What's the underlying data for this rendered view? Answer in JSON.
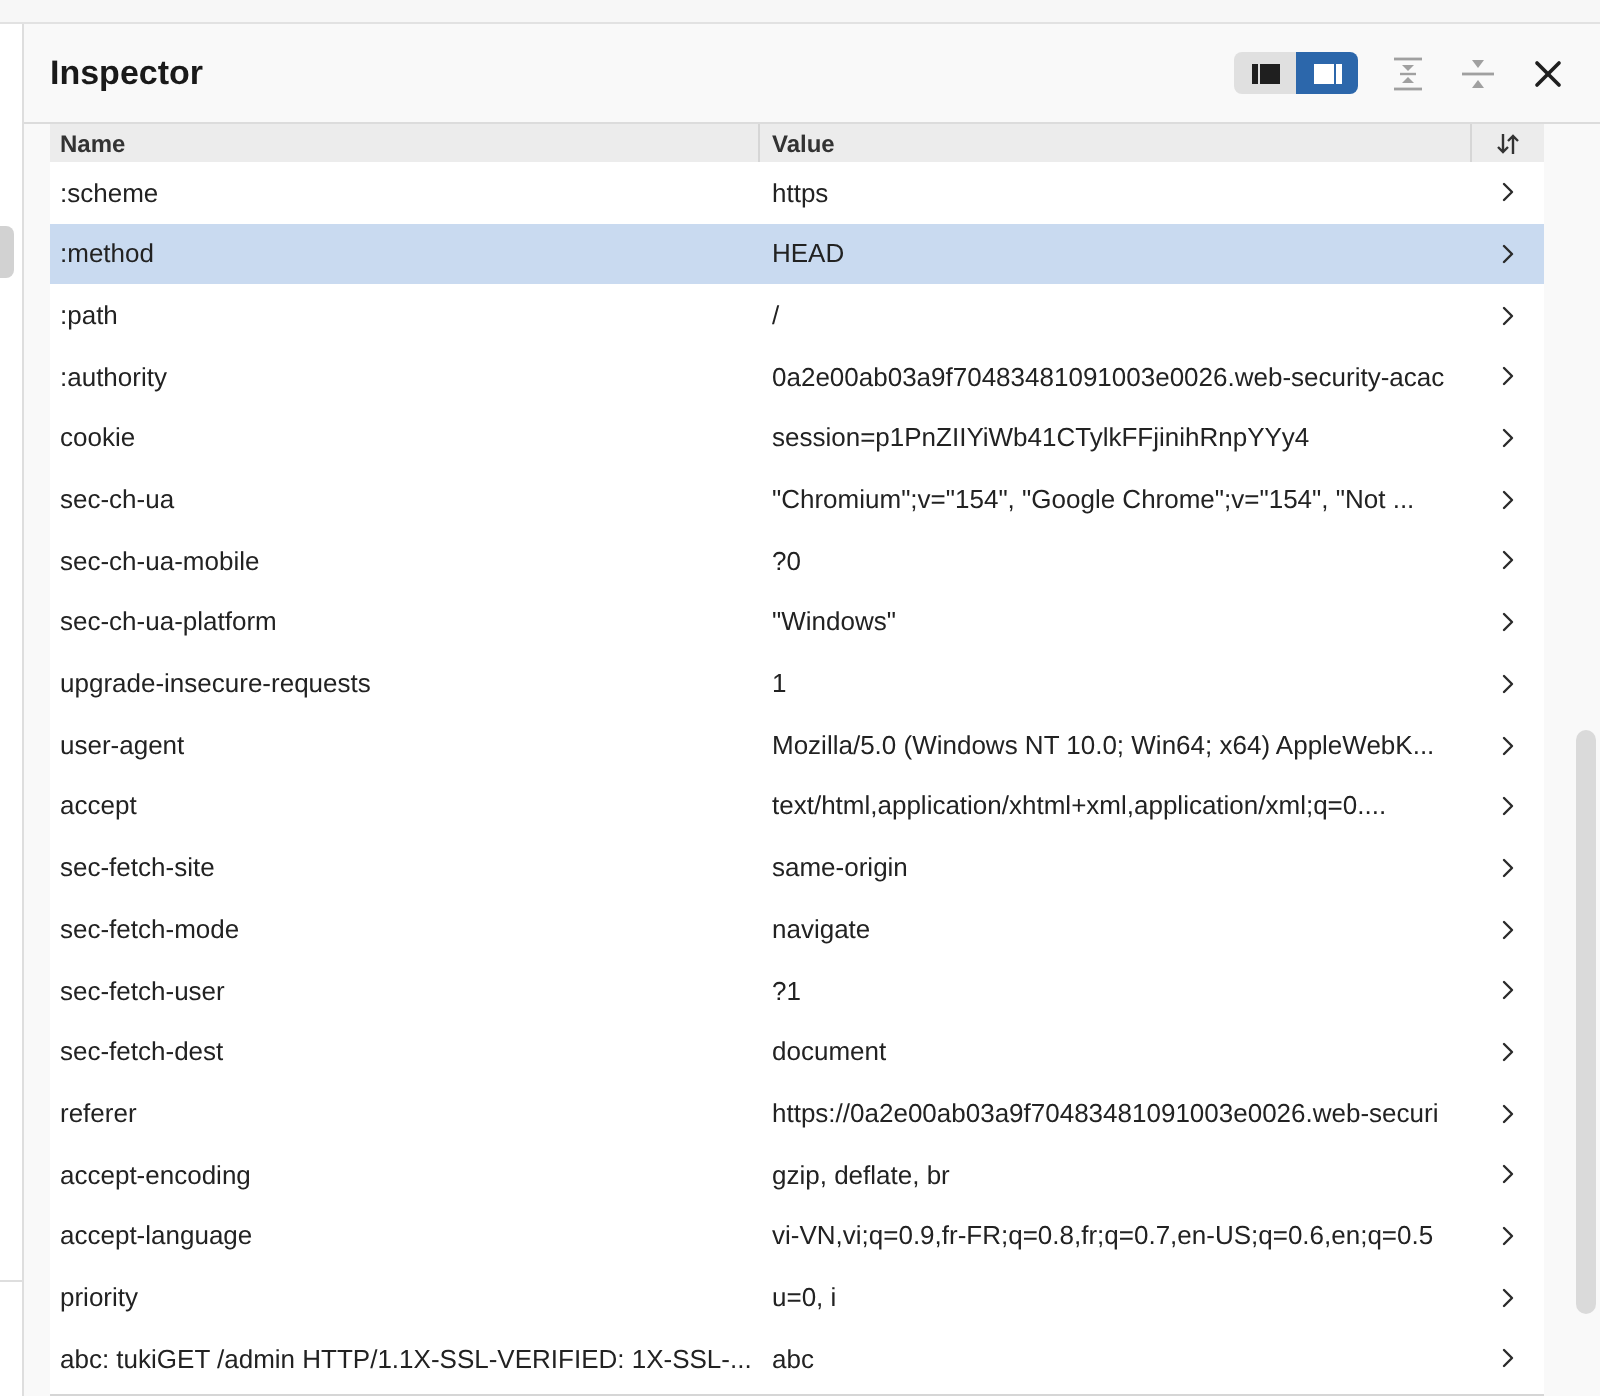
{
  "panel": {
    "title": "Inspector",
    "layout_toggle": [
      {
        "selected": false
      },
      {
        "selected": true
      }
    ]
  },
  "table": {
    "columns": [
      "Name",
      "Value"
    ],
    "rows": [
      {
        "name": ":scheme",
        "value": "https",
        "selected": false
      },
      {
        "name": ":method",
        "value": "HEAD",
        "selected": true
      },
      {
        "name": ":path",
        "value": "/",
        "selected": false
      },
      {
        "name": ":authority",
        "value": "0a2e00ab03a9f70483481091003e0026.web-security-acac",
        "selected": false
      },
      {
        "name": "cookie",
        "value": "session=p1PnZIIYiWb41CTylkFFjinihRnpYYy4",
        "selected": false
      },
      {
        "name": "sec-ch-ua",
        "value": "\"Chromium\";v=\"154\", \"Google Chrome\";v=\"154\", \"Not ...",
        "selected": false
      },
      {
        "name": "sec-ch-ua-mobile",
        "value": "?0",
        "selected": false
      },
      {
        "name": "sec-ch-ua-platform",
        "value": "\"Windows\"",
        "selected": false
      },
      {
        "name": "upgrade-insecure-requests",
        "value": "1",
        "selected": false
      },
      {
        "name": "user-agent",
        "value": "Mozilla/5.0 (Windows NT 10.0; Win64; x64) AppleWebK...",
        "selected": false
      },
      {
        "name": "accept",
        "value": "text/html,application/xhtml+xml,application/xml;q=0....",
        "selected": false
      },
      {
        "name": "sec-fetch-site",
        "value": "same-origin",
        "selected": false
      },
      {
        "name": "sec-fetch-mode",
        "value": "navigate",
        "selected": false
      },
      {
        "name": "sec-fetch-user",
        "value": "?1",
        "selected": false
      },
      {
        "name": "sec-fetch-dest",
        "value": "document",
        "selected": false
      },
      {
        "name": "referer",
        "value": "https://0a2e00ab03a9f70483481091003e0026.web-securi",
        "selected": false
      },
      {
        "name": "accept-encoding",
        "value": "gzip, deflate, br",
        "selected": false
      },
      {
        "name": "accept-language",
        "value": "vi-VN,vi;q=0.9,fr-FR;q=0.8,fr;q=0.7,en-US;q=0.6,en;q=0.5",
        "selected": false
      },
      {
        "name": "priority",
        "value": "u=0, i",
        "selected": false
      },
      {
        "name": "abc: tukiGET /admin HTTP/1.1X-SSL-VERIFIED: 1X-SSL-...",
        "value": "abc",
        "selected": false
      }
    ]
  }
}
